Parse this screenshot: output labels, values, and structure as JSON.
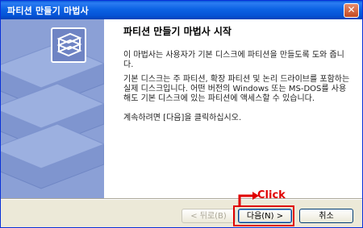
{
  "window": {
    "title": "파티션 만들기 마법사"
  },
  "main": {
    "heading": "파티션 만들기 마법사 시작",
    "paragraph1": "이 마법사는 사용자가 기본 디스크에 파티션을 만들도록 도와 줍니다.",
    "paragraph2": "기본 디스크는 주 파티션, 확장 파티션 및 논리 드라이브를 포함하는 실제 디스크입니다. 어떤 버전의 Windows 또는 MS-DOS를 사용해도 기본 디스크에 있는 파티션에 액세스할 수 있습니다.",
    "paragraph3": "계속하려면 [다음]을 클릭하십시오."
  },
  "buttons": {
    "back": "< 뒤로(B)",
    "next": "다음(N) >",
    "cancel": "취소"
  },
  "annotation": {
    "label": "Click",
    "color": "#e00000"
  },
  "colors": {
    "titlebar": "#0553d6",
    "sidebar": "#8ba0d6"
  }
}
